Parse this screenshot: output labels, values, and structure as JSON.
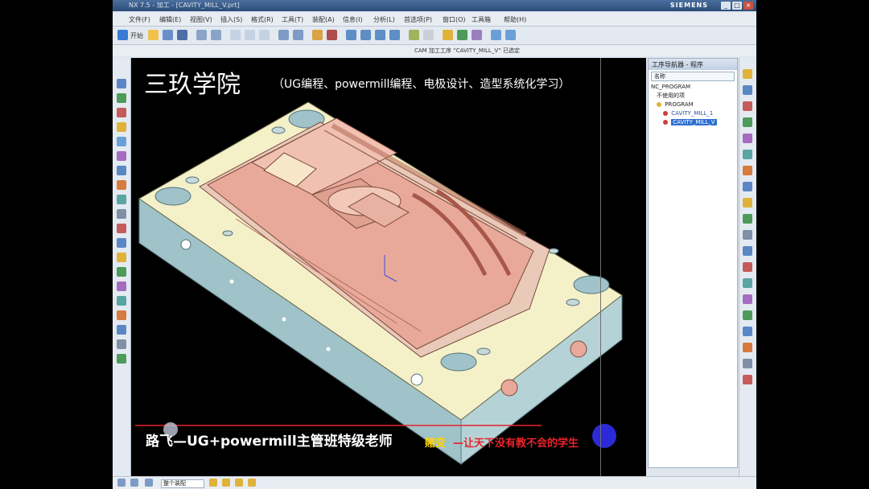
{
  "window": {
    "title": "NX 7.5 - 加工 - [CAVITY_MILL_V.prt]",
    "brand": "SIEMENS"
  },
  "menu": [
    "文件(F)",
    "编辑(E)",
    "视图(V)",
    "插入(S)",
    "格式(R)",
    "工具(T)",
    "装配(A)",
    "信息(I)",
    "分析(L)",
    "首选项(P)",
    "窗口(O)",
    "工具箱",
    "帮助(H)"
  ],
  "toolbar": {
    "start_label": "开始"
  },
  "cam_label": "CAM 加工工序 “CAVITY_MILL_V” 已选定",
  "overlay": {
    "brand_title": "三玖学院",
    "brand_subtitle": "（UG编程、powermill编程、电极设计、造型系统化学习）",
    "teacher": "路飞—UG+powermill主管班特级老师",
    "signature": "赌变",
    "slogan": "—让天下没有教不会的学生"
  },
  "navigator": {
    "title": "工序导航器 - 程序",
    "column": "名称",
    "items": [
      {
        "label": "NC_PROGRAM",
        "level": 0,
        "selected": false
      },
      {
        "label": "不使用的项",
        "level": 1,
        "selected": false
      },
      {
        "label": "PROGRAM",
        "level": 1,
        "selected": false
      },
      {
        "label": "CAVITY_MILL_1",
        "level": 2,
        "selected": false
      },
      {
        "label": "CAVITY_MILL_V",
        "level": 2,
        "selected": true
      }
    ]
  },
  "status": {
    "filter": "整个装配"
  }
}
